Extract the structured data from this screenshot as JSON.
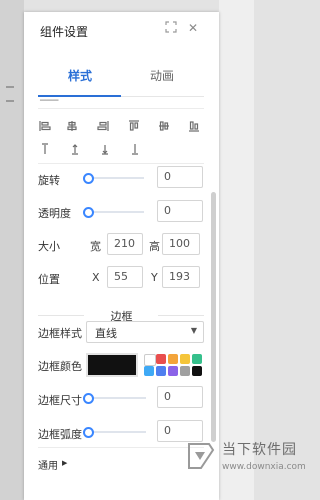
{
  "panel": {
    "title": "组件设置",
    "expand_icon": "expand-icon",
    "close_icon": "close-icon",
    "close_glyph": "✕"
  },
  "tabs": [
    {
      "label": "样式",
      "active": true
    },
    {
      "label": "动画",
      "active": false
    }
  ],
  "alignment": {
    "row1": [
      "align-left-icon",
      "align-center-h-icon",
      "align-right-icon",
      "align-top-icon",
      "align-middle-v-icon",
      "align-bottom-icon"
    ],
    "row2": [
      "distribute-top-icon",
      "distribute-up-icon",
      "distribute-down-icon",
      "distribute-bottom-icon"
    ]
  },
  "rotate": {
    "label": "旋转",
    "value": "0",
    "slider": 0
  },
  "opacity": {
    "label": "透明度",
    "value": "0",
    "slider": 0
  },
  "size": {
    "label": "大小",
    "width_label": "宽",
    "width_value": "210",
    "height_label": "高",
    "height_value": "100"
  },
  "position": {
    "label": "位置",
    "x_label": "X",
    "x_value": "55",
    "y_label": "Y",
    "y_value": "193"
  },
  "border": {
    "section_title": "边框",
    "style_label": "边框样式",
    "style_value": "直线",
    "color_label": "边框颜色",
    "color_value": "#111111",
    "palette": [
      "#ffffff",
      "#e94e4e",
      "#f3a43b",
      "#f5c53a",
      "#35c08c",
      "#3fa9f5",
      "#4f7fef",
      "#8b63e8",
      "#a0a0a0",
      "#111111"
    ],
    "width_label": "边框尺寸",
    "width_value": "0",
    "width_slider": 0,
    "radius_label": "边框弧度",
    "radius_value": "0",
    "radius_slider": 0
  },
  "general": {
    "label": "通用"
  },
  "watermark": {
    "title": "当下软件园",
    "url": "www.downxia.com"
  }
}
